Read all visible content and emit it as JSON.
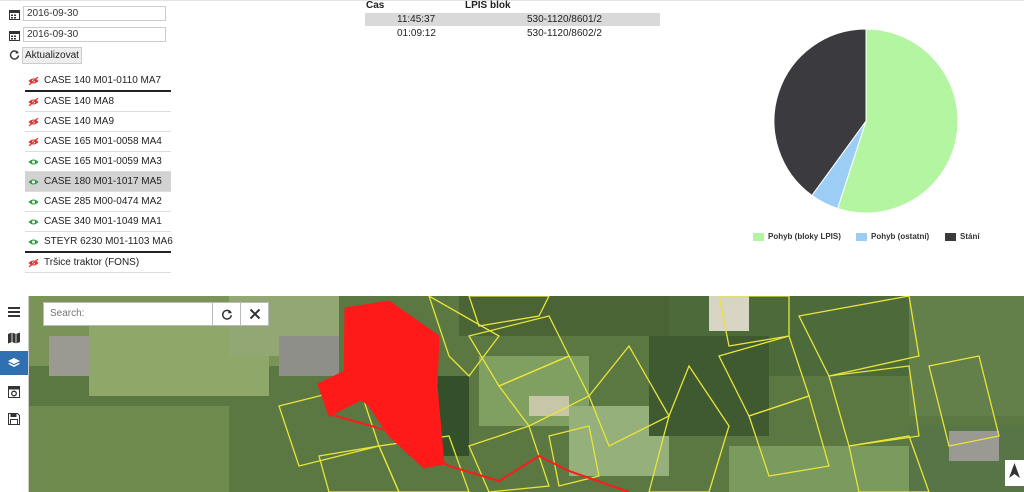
{
  "filters": {
    "date_from": "2016-09-30",
    "date_to": "2016-09-30",
    "refresh_label": "Aktualizovat"
  },
  "vehicles": [
    {
      "label": "CASE 140 M01-0110 MA7",
      "visible": false
    },
    {
      "label": "CASE 140 MA8",
      "visible": false
    },
    {
      "label": "CASE 140 MA9",
      "visible": false
    },
    {
      "label": "CASE 165 M01-0058 MA4",
      "visible": false
    },
    {
      "label": "CASE 165 M01-0059 MA3",
      "visible": true
    },
    {
      "label": "CASE 180 M01-1017 MA5",
      "visible": true,
      "selected": true
    },
    {
      "label": "CASE 285 M00-0474 MA2",
      "visible": true
    },
    {
      "label": "CASE 340 M01-1049 MA1",
      "visible": true
    },
    {
      "label": "STEYR 6230 M01-1103 MA6",
      "visible": true
    },
    {
      "label": "Tršice traktor (FONS)",
      "visible": false
    }
  ],
  "table": {
    "headers": [
      "Cas",
      "LPIS blok"
    ],
    "rows": [
      [
        "11:45:37",
        "530-1120/8601/2"
      ],
      [
        "01:09:12",
        "530-1120/8602/2"
      ]
    ]
  },
  "pie": {
    "slices": [
      {
        "label": "Pohyb (bloky LPIS)",
        "fraction": 0.55,
        "color": "#b3f5a0"
      },
      {
        "label": "Pohyb (ostatní)",
        "fraction": 0.05,
        "color": "#9ccdf5"
      },
      {
        "label": "Stání",
        "fraction": 0.4,
        "color": "#3a3a3f"
      }
    ]
  },
  "map": {
    "search_placeholder": "Search:",
    "sidebar_icons": [
      "menu-icon",
      "map-icon",
      "layers-icon",
      "camera-icon",
      "save-icon"
    ]
  },
  "colors": {
    "eye_hidden": "#e03030",
    "eye_visible": "#2e9e3e",
    "active_tool": "#2f70b3",
    "field_outline": "#e8e43a",
    "highlight_field": "#ff1a1a"
  }
}
